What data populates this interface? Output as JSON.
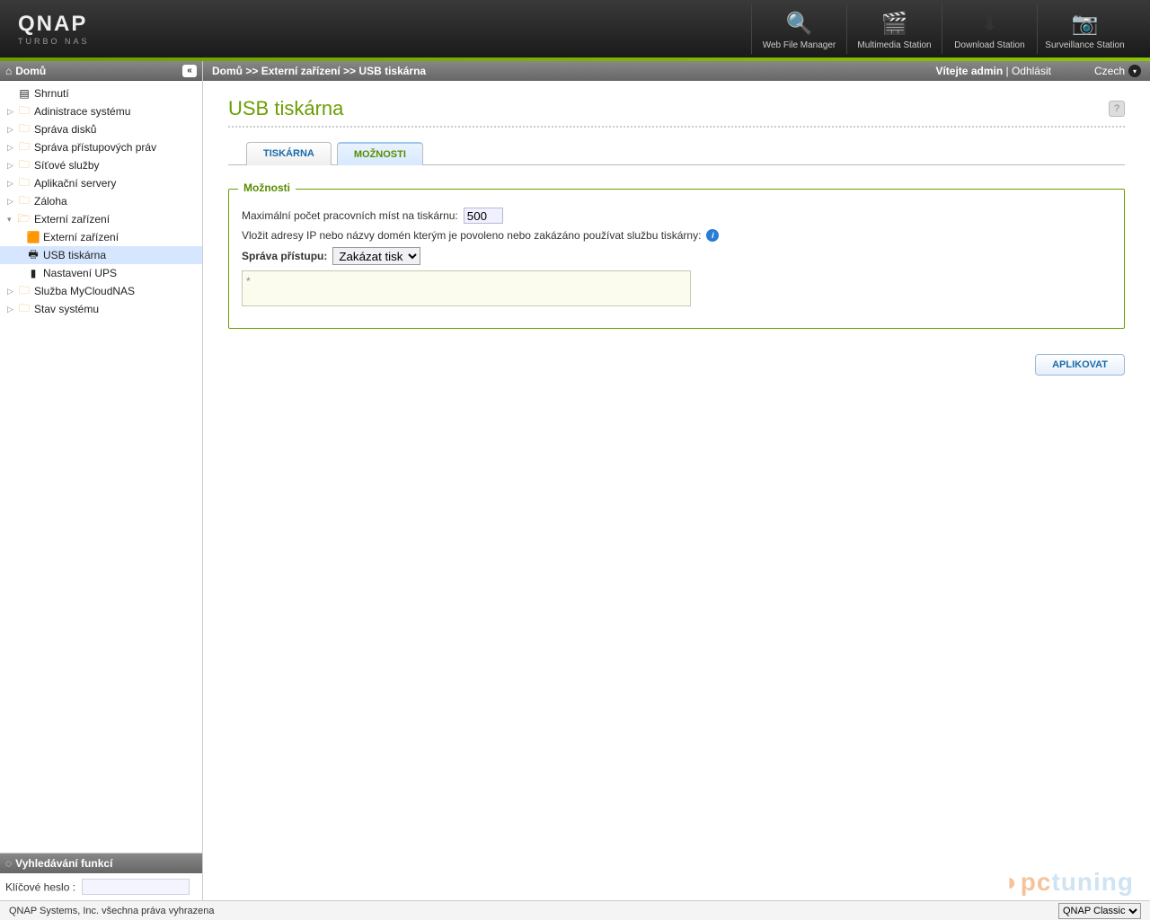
{
  "brand": {
    "name": "QNAP",
    "sub": "TURBO NAS"
  },
  "header_apps": [
    {
      "label": "Web File Manager",
      "icon": "🔍"
    },
    {
      "label": "Multimedia Station",
      "icon": "🎬"
    },
    {
      "label": "Download Station",
      "icon": "⬇"
    },
    {
      "label": "Surveillance Station",
      "icon": "📷"
    }
  ],
  "sidebar": {
    "home_label": "Domů",
    "items": [
      {
        "label": "Shrnutí",
        "type": "page",
        "icon": "📄"
      },
      {
        "label": "Adinistrace systému",
        "type": "folder"
      },
      {
        "label": "Správa disků",
        "type": "folder"
      },
      {
        "label": "Správa přístupových práv",
        "type": "folder"
      },
      {
        "label": "Síťové služby",
        "type": "folder"
      },
      {
        "label": "Aplikační servery",
        "type": "folder"
      },
      {
        "label": "Záloha",
        "type": "folder"
      },
      {
        "label": "Externí zařízení",
        "type": "folder",
        "expanded": true,
        "children": [
          {
            "label": "Externí zařízení",
            "icon": "🔌"
          },
          {
            "label": "USB tiskárna",
            "icon": "🖨",
            "selected": true
          },
          {
            "label": "Nastavení UPS",
            "icon": "🔋"
          }
        ]
      },
      {
        "label": "Služba MyCloudNAS",
        "type": "folder"
      },
      {
        "label": "Stav systému",
        "type": "folder"
      }
    ],
    "search_title": "Vyhledávání funkcí",
    "search_label": "Klíčové heslo :",
    "search_value": ""
  },
  "breadcrumb": {
    "parts": [
      "Domů",
      "Externí zařízení",
      "USB tiskárna"
    ],
    "welcome": "Vítejte admin",
    "logout": "Odhlásit",
    "language": "Czech"
  },
  "page": {
    "title": "USB tiskárna",
    "tabs": [
      {
        "label": "TISKÁRNA",
        "active": false
      },
      {
        "label": "MOŽNOSTI",
        "active": true
      }
    ],
    "fieldset_legend": "Možnosti",
    "max_jobs_label": "Maximální počet pracovních míst na tiskárnu:",
    "max_jobs_value": "500",
    "ip_help_text": "Vložit adresy IP nebo názvy domén kterým je povoleno nebo zakázáno používat službu tiskárny:",
    "access_label": "Správa přístupu:",
    "access_value": "Zakázat tisk",
    "access_options": [
      "Zakázat tisk"
    ],
    "ip_textarea": "*",
    "apply_label": "APLIKOVAT"
  },
  "footer": {
    "copyright": "QNAP Systems, Inc. všechna práva vyhrazena",
    "theme_value": "QNAP Classic"
  },
  "watermark": {
    "pc": "pc",
    "tuning": "tuning"
  }
}
